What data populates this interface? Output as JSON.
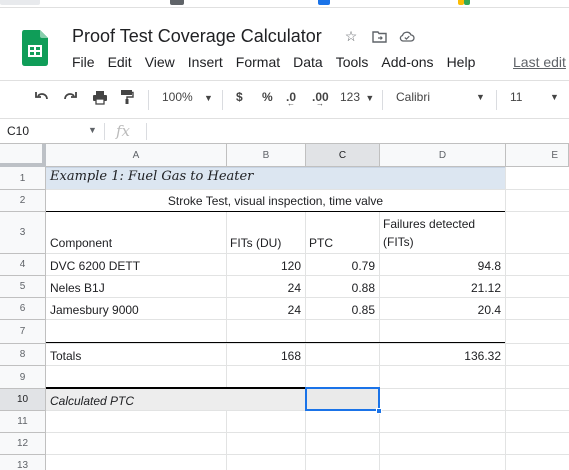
{
  "header": {
    "title": "Proof Test Coverage Calculator",
    "menus": [
      "File",
      "Edit",
      "View",
      "Insert",
      "Format",
      "Data",
      "Tools",
      "Add-ons",
      "Help"
    ],
    "last_edit": "Last edit"
  },
  "toolbar": {
    "zoom": "100%",
    "currency": "$",
    "percent": "%",
    "decrease_decimals": ".0",
    "increase_decimals": ".00",
    "number_format": "123",
    "font": "Calibri",
    "font_size": "11"
  },
  "formula_bar": {
    "cell_ref": "C10",
    "fx": "fx"
  },
  "columns": [
    "A",
    "B",
    "C",
    "D",
    "E"
  ],
  "rows": [
    "1",
    "2",
    "3",
    "4",
    "5",
    "6",
    "7",
    "8",
    "9",
    "10",
    "11",
    "12",
    "13"
  ],
  "sheet": {
    "title": "Example 1: Fuel Gas to Heater",
    "subtitle": "Stroke Test, visual inspection, time valve",
    "headers": {
      "component": "Component",
      "fits": "FITs (DU)",
      "ptc": "PTC",
      "failures_line1": "Failures detected",
      "failures_line2": "(FITs)"
    },
    "rows": [
      {
        "component": "DVC 6200 DETT",
        "fits": "120",
        "ptc": "0.79",
        "failures": "94.8"
      },
      {
        "component": "Neles B1J",
        "fits": "24",
        "ptc": "0.88",
        "failures": "21.12"
      },
      {
        "component": "Jamesbury 9000",
        "fits": "24",
        "ptc": "0.85",
        "failures": "20.4"
      }
    ],
    "totals": {
      "label": "Totals",
      "fits": "168",
      "failures": "136.32"
    },
    "calculated_label": "Calculated PTC"
  },
  "colors": {
    "title_fill": "#dce6f1",
    "calc_fill": "#ededed",
    "selection": "#1a73e8",
    "sheets_green": "#0f9d58"
  }
}
